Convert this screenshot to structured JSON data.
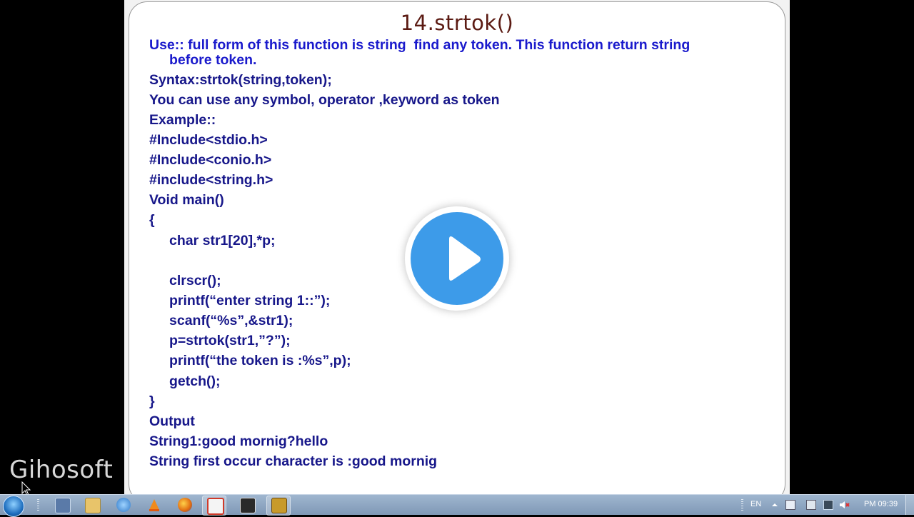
{
  "slide": {
    "title": "14.strtok()",
    "lines": [
      "Use:: full form of this function is string  find any token. This function return string",
      "before token.",
      "Syntax:strtok(string,token);",
      "You can use any symbol, operator ,keyword as token",
      "Example::",
      "#Include<stdio.h>",
      "#Include<conio.h>",
      "#include<string.h>",
      "Void main()",
      "{",
      "char str1[20],*p;",
      "clrscr();",
      "printf(“enter string 1::”);",
      "scanf(“%s”,&str1);",
      "p=strtok(str1,”?”);",
      "printf(“the token is :%s”,p);",
      "getch();",
      "}",
      "Output",
      "String1:good mornig?hello",
      "String first occur character is :good mornig"
    ]
  },
  "overlay": {
    "play_icon": "play-icon",
    "color": "#3d9be9"
  },
  "watermark": "Gihosoft",
  "taskbar": {
    "start": "windows-start-orb",
    "pinned": [
      "explorer-icon",
      "media-icon",
      "vlc-icon",
      "firefox-icon",
      "camtasia-icon",
      "film-icon",
      "dosbox-icon"
    ],
    "tray": {
      "language": "EN",
      "clock": "PM 09:39"
    }
  }
}
